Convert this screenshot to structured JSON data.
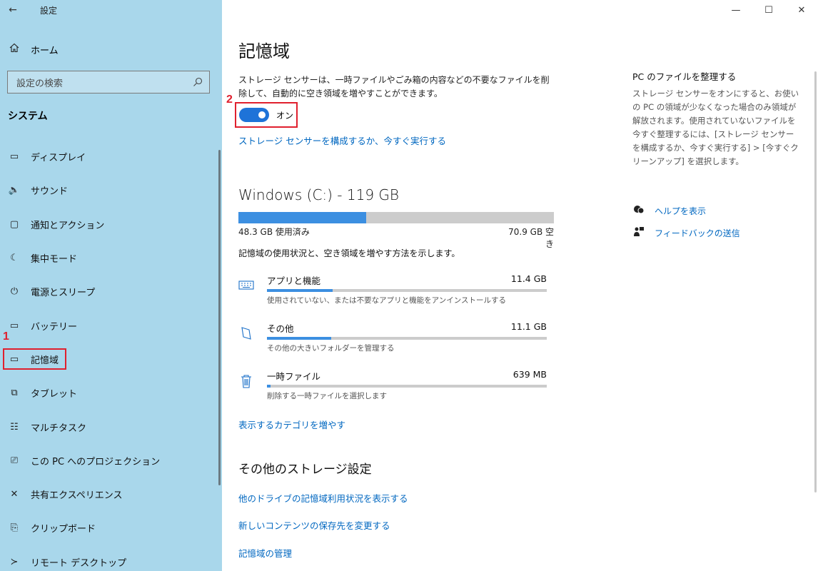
{
  "window": {
    "title": "設定",
    "back_glyph": "←",
    "minimize_glyph": "—",
    "maximize_glyph": "☐",
    "close_glyph": "✕"
  },
  "sidebar": {
    "home_label": "ホーム",
    "search_placeholder": "設定の検索",
    "section_title": "システム",
    "items": [
      {
        "label": "ディスプレイ",
        "icon": "display-icon",
        "glyph": "▭"
      },
      {
        "label": "サウンド",
        "icon": "sound-icon",
        "glyph": "🔈"
      },
      {
        "label": "通知とアクション",
        "icon": "notification-icon",
        "glyph": "▢"
      },
      {
        "label": "集中モード",
        "icon": "moon-icon",
        "glyph": "☾"
      },
      {
        "label": "電源とスリープ",
        "icon": "power-icon",
        "glyph": "⏻"
      },
      {
        "label": "バッテリー",
        "icon": "battery-icon",
        "glyph": "▭"
      },
      {
        "label": "記憶域",
        "icon": "storage-icon",
        "glyph": "▭",
        "selected": true
      },
      {
        "label": "タブレット",
        "icon": "tablet-icon",
        "glyph": "⧉"
      },
      {
        "label": "マルチタスク",
        "icon": "multitask-icon",
        "glyph": "☷"
      },
      {
        "label": "この PC へのプロジェクション",
        "icon": "projection-icon",
        "glyph": "⎚"
      },
      {
        "label": "共有エクスペリエンス",
        "icon": "share-icon",
        "glyph": "✕"
      },
      {
        "label": "クリップボード",
        "icon": "clipboard-icon",
        "glyph": "⎘"
      },
      {
        "label": "リモート デスクトップ",
        "icon": "remote-icon",
        "glyph": "≻"
      }
    ]
  },
  "annotations": {
    "step1": "1",
    "step2": "2"
  },
  "main": {
    "page_title": "記憶域",
    "description": "ストレージ センサーは、一時ファイルやごみ箱の内容などの不要なファイルを削除して、自動的に空き領域を増やすことができます。",
    "toggle_state": "オン",
    "toggle_on": true,
    "configure_link": "ストレージ センサーを構成するか、今すぐ実行する",
    "drive_title": "Windows (C:) - 119 GB",
    "drive_used_fraction": 0.405,
    "used_label": "48.3 GB 使用済み",
    "free_label": "70.9 GB 空き",
    "usage_desc": "記憶域の使用状況と、空き領域を増やす方法を示します。",
    "categories": [
      {
        "name": "アプリと機能",
        "size": "11.4 GB",
        "sub": "使用されていない、または不要なアプリと機能をアンインストールする",
        "fill": 0.235,
        "icon": "apps-icon"
      },
      {
        "name": "その他",
        "size": "11.1 GB",
        "sub": "その他の大きいフォルダーを管理する",
        "fill": 0.23,
        "icon": "other-icon"
      },
      {
        "name": "一時ファイル",
        "size": "639 MB",
        "sub": "削除する一時ファイルを選択します",
        "fill": 0.013,
        "icon": "trash-icon"
      }
    ],
    "show_more_link": "表示するカテゴリを増やす",
    "more_settings_title": "その他のストレージ設定",
    "more_links": [
      "他のドライブの記憶域利用状況を表示する",
      "新しいコンテンツの保存先を変更する",
      "記憶域の管理"
    ]
  },
  "right_panel": {
    "title": "PC のファイルを整理する",
    "text": "ストレージ センサーをオンにすると、お使いの PC の領域が少なくなった場合のみ領域が解放されます。使用されていないファイルを今すぐ整理するには、[ストレージ センサーを構成するか、今すぐ実行する] > [今すぐクリーンアップ] を選択します。",
    "help_link": "ヘルプを表示",
    "feedback_link": "フィードバックの送信"
  },
  "colors": {
    "sidebar_bg": "#a9d7eb",
    "accent": "#0067c0",
    "toggle_on": "#1e73d8",
    "bar_fill": "#3c8fe1",
    "annotation": "#e0202e"
  }
}
